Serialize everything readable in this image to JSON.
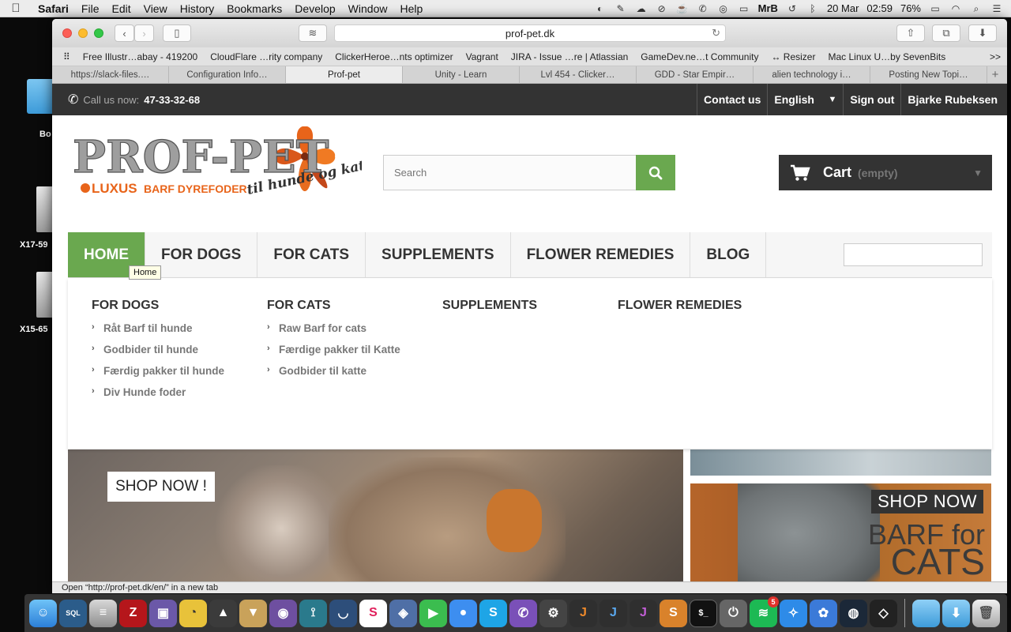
{
  "menubar": {
    "app": "Safari",
    "items": [
      "File",
      "Edit",
      "View",
      "History",
      "Bookmarks",
      "Develop",
      "Window",
      "Help"
    ],
    "status_user": "MrB",
    "date": "20 Mar",
    "time": "02:59",
    "battery": "76%"
  },
  "desktop": {
    "items": [
      "Bo",
      "X17-59",
      "X15-65"
    ]
  },
  "browser": {
    "url": "prof-pet.dk",
    "bookmarks": [
      "Free Illustr…abay - 419200",
      "CloudFlare …rity company",
      "ClickerHeroe…nts optimizer",
      "Vagrant",
      "JIRA - Issue …re | Atlassian",
      "GameDev.ne…t Community",
      "↔ Resizer",
      "Mac Linux U…by SevenBits"
    ],
    "bookmarks_more": ">>",
    "tabs": [
      "https://slack-files.…",
      "Configuration Info…",
      "Prof-pet",
      "Unity - Learn",
      "Lvl 454 - Clicker…",
      "GDD - Star Empir…",
      "alien technology i…",
      "Posting New Topi…"
    ],
    "active_tab_index": 2,
    "status_text": "Open “http://prof-pet.dk/en/” in a new tab"
  },
  "site": {
    "topbar": {
      "call_label": "Call us now:",
      "phone": "47-33-32-68",
      "contact": "Contact us",
      "language": "English",
      "signout": "Sign out",
      "user": "Bjarke Rubeksen"
    },
    "logo": {
      "title": "PROF-PET",
      "tagline_a": "LUXUS",
      "tagline_b": "BARF DYREFODER",
      "tagline_c": "til hunde og katte"
    },
    "search_placeholder": "Search",
    "cart": {
      "label": "Cart",
      "status": "(empty)"
    },
    "nav": [
      "HOME",
      "FOR DOGS",
      "FOR CATS",
      "SUPPLEMENTS",
      "FLOWER REMEDIES",
      "BLOG"
    ],
    "tooltip": "Home",
    "dropdown": {
      "dogs": {
        "title": "FOR DOGS",
        "links": [
          "Råt Barf til hunde",
          "Godbider til hunde",
          "Færdig pakker til hunde",
          "Div Hunde foder"
        ]
      },
      "cats": {
        "title": "FOR CATS",
        "links": [
          "Raw Barf for cats",
          "Færdige pakker til Katte",
          "Godbider til katte"
        ]
      },
      "supplements": {
        "title": "SUPPLEMENTS"
      },
      "flower": {
        "title": "FLOWER REMEDIES"
      }
    },
    "banner_left": {
      "button": "SHOP NOW !"
    },
    "banner_right": {
      "shop": "SHOP NOW",
      "line1": "BARF for",
      "line2": "CATS"
    }
  },
  "dock": {
    "spotify_badge": "5"
  },
  "colors": {
    "accent_green": "#6aa84f",
    "dark_bar": "#333333",
    "logo_orange": "#e8641a"
  }
}
